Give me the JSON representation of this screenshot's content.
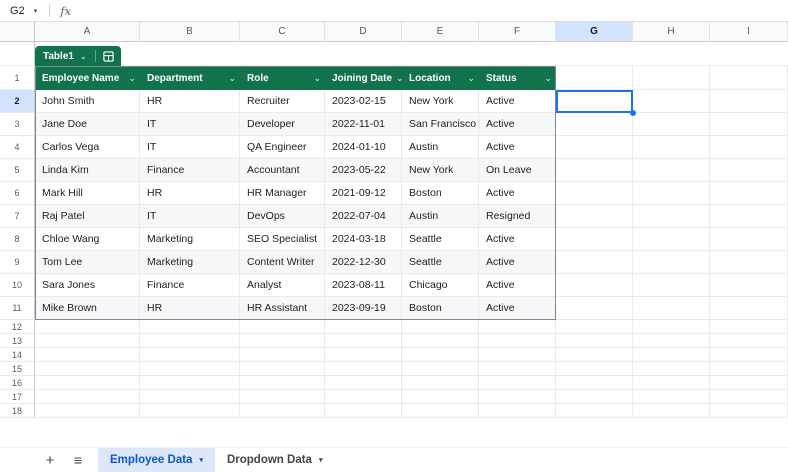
{
  "name_box": {
    "value": "G2"
  },
  "formula_bar": {
    "fx_label": "fx"
  },
  "columns": [
    "A",
    "B",
    "C",
    "D",
    "E",
    "F",
    "G",
    "H",
    "I"
  ],
  "row_numbers": [
    "1",
    "2",
    "3",
    "4",
    "5",
    "6",
    "7",
    "8",
    "9",
    "10",
    "11",
    "12",
    "13",
    "14",
    "15",
    "16",
    "17",
    "18"
  ],
  "selection": {
    "cell": "G2",
    "column": "G",
    "row": "2"
  },
  "table": {
    "name": "Table1",
    "headers": [
      "Employee Name",
      "Department",
      "Role",
      "Joining Date",
      "Location",
      "Status"
    ],
    "data": [
      [
        "John Smith",
        "HR",
        "Recruiter",
        "2023-02-15",
        "New York",
        "Active"
      ],
      [
        "Jane Doe",
        "IT",
        "Developer",
        "2022-11-01",
        "San Francisco",
        "Active"
      ],
      [
        "Carlos Vega",
        "IT",
        "QA Engineer",
        "2024-01-10",
        "Austin",
        "Active"
      ],
      [
        "Linda Kim",
        "Finance",
        "Accountant",
        "2023-05-22",
        "New York",
        "On Leave"
      ],
      [
        "Mark Hill",
        "HR",
        "HR Manager",
        "2021-09-12",
        "Boston",
        "Active"
      ],
      [
        "Raj Patel",
        "IT",
        "DevOps",
        "2022-07-04",
        "Austin",
        "Resigned"
      ],
      [
        "Chloe Wang",
        "Marketing",
        "SEO Specialist",
        "2024-03-18",
        "Seattle",
        "Active"
      ],
      [
        "Tom Lee",
        "Marketing",
        "Content Writer",
        "2022-12-30",
        "Seattle",
        "Active"
      ],
      [
        "Sara Jones",
        "Finance",
        "Analyst",
        "2023-08-11",
        "Chicago",
        "Active"
      ],
      [
        "Mike Brown",
        "HR",
        "HR Assistant",
        "2023-09-19",
        "Boston",
        "Active"
      ]
    ]
  },
  "icons": {
    "name_box_caret": "▾",
    "chevron": "⌄",
    "chip_caret": "⌄",
    "add_icon": "+",
    "all_sheets_icon": "≡",
    "tab_caret": "▾"
  },
  "tabs": {
    "active": "Employee Data",
    "inactive": "Dropdown Data"
  },
  "colors": {
    "header_green": "#11734b",
    "selected_header_bg": "#d3e3fd",
    "selection_blue": "#1a73e8",
    "active_tab_bg": "#dde7f8",
    "active_tab_text": "#0b57d0",
    "band_row": "#f6f7f8"
  }
}
